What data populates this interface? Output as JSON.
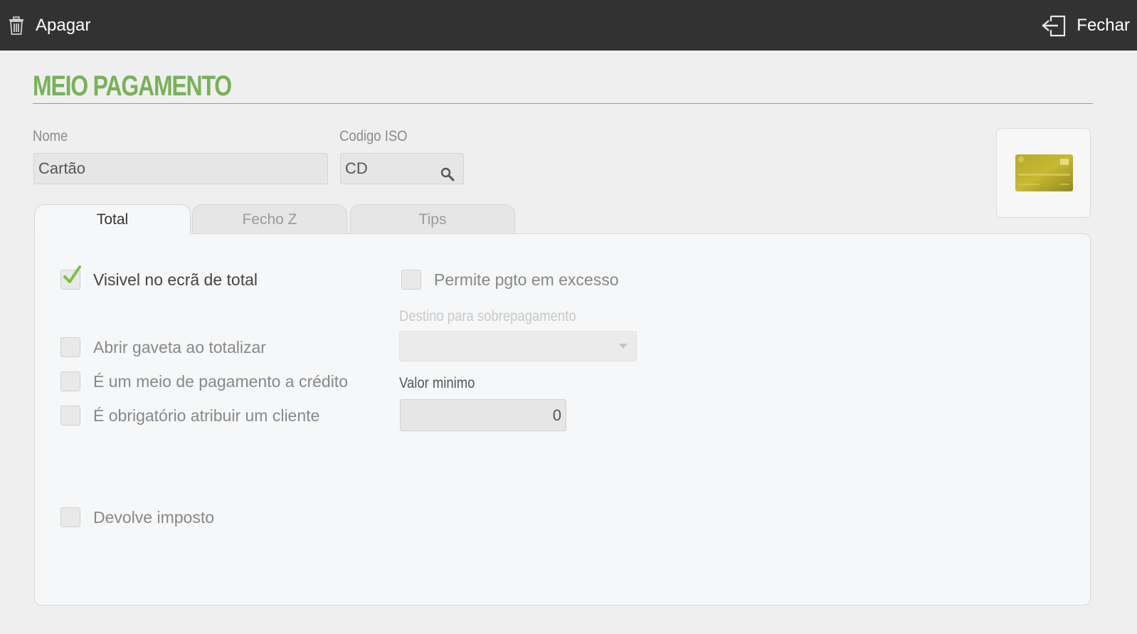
{
  "topbar": {
    "delete_label": "Apagar",
    "close_label": "Fechar",
    "background": "#323232"
  },
  "page": {
    "title": "MEIO PAGAMENTO",
    "title_color": "#78b159"
  },
  "form": {
    "name_label": "Nome",
    "name_value": "Cartão",
    "iso_label": "Codigo ISO",
    "iso_value": "CD"
  },
  "tabs": [
    {
      "label": "Total",
      "active": true
    },
    {
      "label": "Fecho Z",
      "active": false
    },
    {
      "label": "Tips",
      "active": false
    }
  ],
  "options": {
    "visible_total": {
      "label": "Visivel no ecrã de total",
      "checked": true
    },
    "open_drawer": {
      "label": "Abrir gaveta ao totalizar",
      "checked": false
    },
    "credit_payment": {
      "label": "É um meio de pagamento a crédito",
      "checked": false
    },
    "require_client": {
      "label": "É obrigatório atribuir um cliente",
      "checked": false
    },
    "return_tax": {
      "label": "Devolve imposto",
      "checked": false
    },
    "allow_overpay": {
      "label": "Permite pgto em excesso",
      "checked": false
    }
  },
  "overpay_destination": {
    "label": "Destino para sobrepagamento",
    "value": ""
  },
  "min_value": {
    "label": "Valor minimo",
    "value": "0"
  },
  "icons": {
    "delete": "trash-icon",
    "close": "exit-icon",
    "search": "search-icon",
    "card": "credit-card-image",
    "check": "checkmark-icon"
  },
  "colors": {
    "check": "#7cc043",
    "panel": "#f6f7f8"
  }
}
